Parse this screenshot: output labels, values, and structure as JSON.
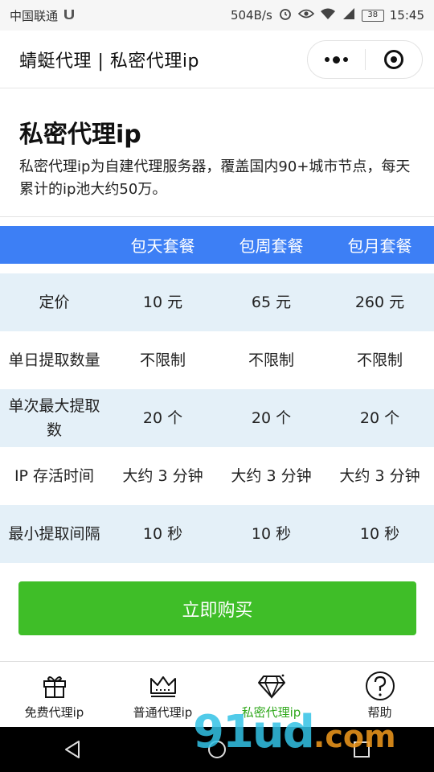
{
  "status_bar": {
    "carrier": "中国联通",
    "speed": "504B/s",
    "battery": "38",
    "time": "15:45"
  },
  "nav": {
    "title": "蜻蜓代理 | 私密代理ip"
  },
  "intro": {
    "title": "私密代理ip",
    "description": "私密代理ip为自建代理服务器，覆盖国内90+城市节点，每天累计的ip池大约50万。"
  },
  "table": {
    "headers": [
      "",
      "包天套餐",
      "包周套餐",
      "包月套餐"
    ],
    "rows": [
      [
        "定价",
        "10 元",
        "65 元",
        "260 元"
      ],
      [
        "单日提取数量",
        "不限制",
        "不限制",
        "不限制"
      ],
      [
        "单次最大提取数",
        "20 个",
        "20 个",
        "20 个"
      ],
      [
        "IP 存活时间",
        "大约 3 分钟",
        "大约 3 分钟",
        "大约 3 分钟"
      ],
      [
        "最小提取间隔",
        "10 秒",
        "10 秒",
        "10 秒"
      ]
    ]
  },
  "buy_button": {
    "label": "立即购买"
  },
  "tabs": [
    {
      "label": "免费代理ip",
      "icon": "gift-icon"
    },
    {
      "label": "普通代理ip",
      "icon": "crown-icon"
    },
    {
      "label": "私密代理ip",
      "icon": "diamond-icon"
    },
    {
      "label": "帮助",
      "icon": "question-icon"
    }
  ],
  "watermark": {
    "main": "91ud",
    "suffix": ".com"
  },
  "colors": {
    "header_blue": "#3d7ff5",
    "row_shade": "#e4f0f8",
    "buy_green": "#3fbe28",
    "active_tab": "#2fa81b"
  }
}
